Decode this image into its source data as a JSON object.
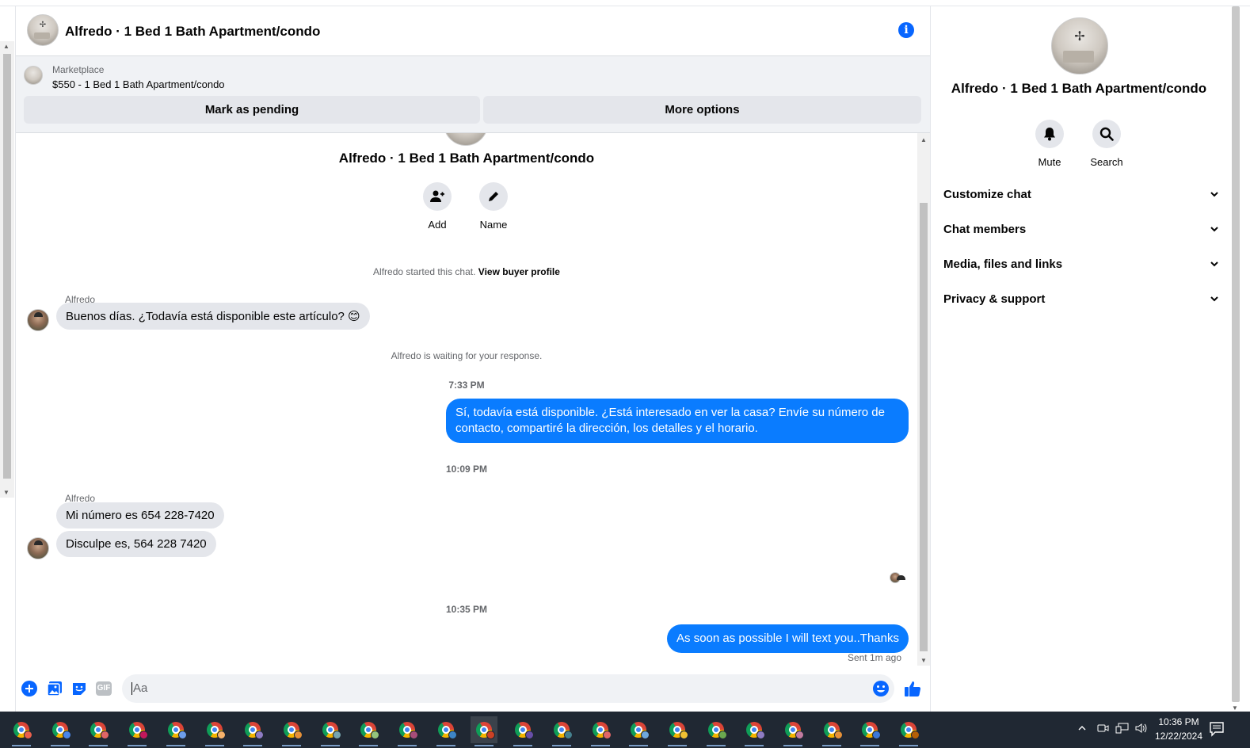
{
  "header": {
    "title": "Alfredo · 1 Bed 1 Bath Apartment/condo",
    "info_icon": "info-icon"
  },
  "marketplace": {
    "source": "Marketplace",
    "listing": "$550 - 1 Bed 1 Bath Apartment/condo",
    "mark_pending_label": "Mark as pending",
    "more_options_label": "More options"
  },
  "thread": {
    "title": "Alfredo · 1 Bed 1 Bath Apartment/condo",
    "actions": [
      {
        "label": "Add",
        "icon": "add-person-icon"
      },
      {
        "label": "Name",
        "icon": "pencil-icon"
      }
    ],
    "started_text": "Alfredo started this chat.",
    "view_buyer_profile": "View buyer profile",
    "messages": {
      "sender_1": "Alfredo",
      "in_1": "Buenos días. ¿Todavía está disponible este artículo? 😊",
      "waiting_text": "Alfredo is waiting for your response.",
      "time_1": "7:33 PM",
      "out_1_line1": "Sí, todavía está disponible. ¿Está interesado en ver la casa? Envíe su número de",
      "out_1_line2": "contacto, compartiré la dirección, los detalles y el horario.",
      "time_2": "10:09 PM",
      "sender_2": "Alfredo",
      "in_2": "Mi número es 654 228-7420",
      "in_3": "Disculpe es, 564 228 7420",
      "time_3": "10:35 PM",
      "out_2": "As soon as possible I will text you..Thanks",
      "sent_status": "Sent 1m ago"
    }
  },
  "composer": {
    "placeholder": "Aa",
    "icons": [
      "plus-icon",
      "photo-icon",
      "sticker-icon",
      "gif-icon",
      "emoji-icon",
      "thumbs-up-icon"
    ],
    "gif_label": "GIF"
  },
  "panel": {
    "title": "Alfredo · 1 Bed 1 Bath Apartment/condo",
    "mute_label": "Mute",
    "search_label": "Search",
    "sections": [
      {
        "label": "Customize chat"
      },
      {
        "label": "Chat members"
      },
      {
        "label": "Media, files and links"
      },
      {
        "label": "Privacy & support"
      }
    ]
  },
  "taskbar": {
    "time": "10:36 PM",
    "date": "12/22/2024",
    "app_count": 24
  },
  "colors": {
    "accent": "#0866ff",
    "outgoing_bubble": "#0a7cff",
    "incoming_bubble": "#e4e6eb",
    "taskbar": "#202833"
  }
}
